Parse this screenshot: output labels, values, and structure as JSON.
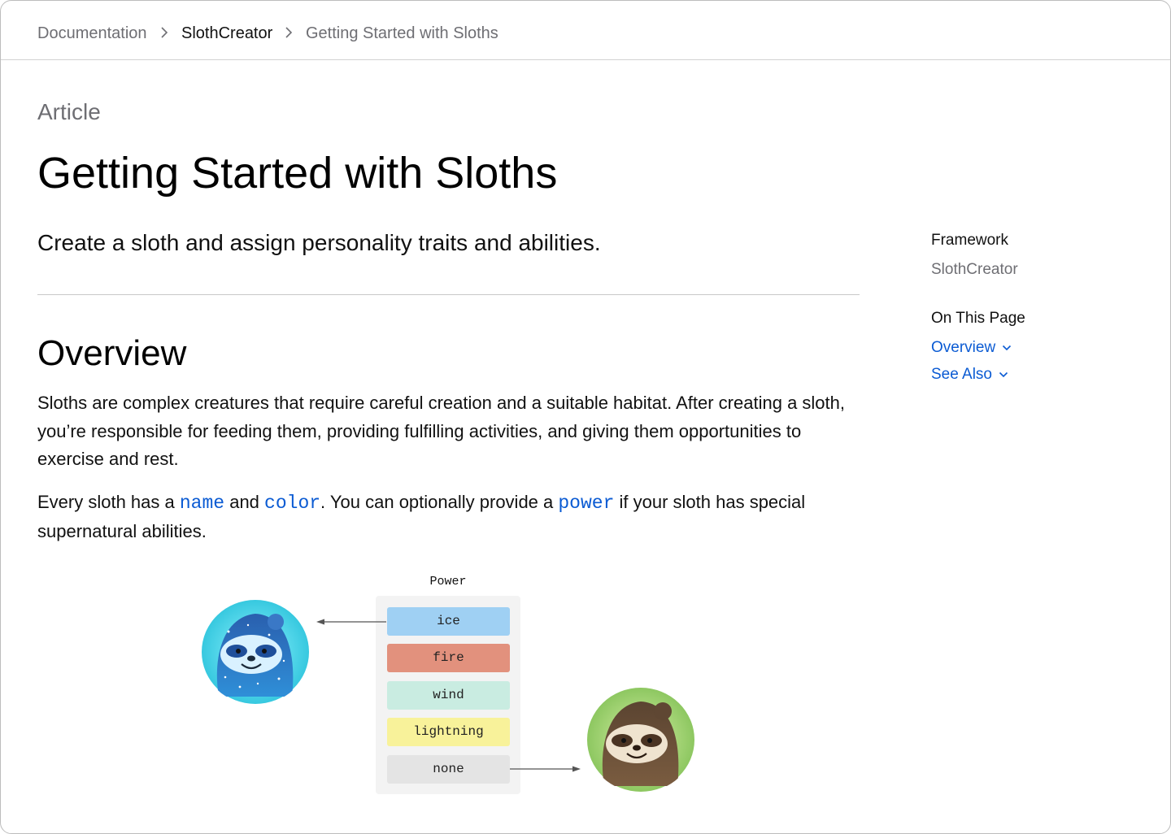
{
  "breadcrumb": {
    "items": [
      "Documentation",
      "SlothCreator",
      "Getting Started with Sloths"
    ]
  },
  "article": {
    "eyebrow": "Article",
    "title": "Getting Started with Sloths",
    "abstract": "Create a sloth and assign personality traits and abilities."
  },
  "overview": {
    "heading": "Overview",
    "paragraph1": "Sloths are complex creatures that require careful creation and a suitable habitat. After creating a sloth, you’re responsible for feeding them, providing fulfilling activities, and giving them opportunities to exercise and rest.",
    "p2_part1": "Every sloth has a ",
    "p2_code1": "name",
    "p2_part2": " and ",
    "p2_code2": "color",
    "p2_part3": ". You can optionally provide a ",
    "p2_code3": "power",
    "p2_part4": " if your sloth has special supernatural abilities."
  },
  "sidebar": {
    "framework_label": "Framework",
    "framework_value": "SlothCreator",
    "on_this_page_label": "On This Page",
    "links": [
      "Overview",
      "See Also"
    ]
  },
  "figure": {
    "caption": "Power",
    "powers": [
      {
        "label": "ice",
        "color": "#9fd0f3"
      },
      {
        "label": "fire",
        "color": "#e2917d"
      },
      {
        "label": "wind",
        "color": "#c9ece1"
      },
      {
        "label": "lightning",
        "color": "#f8f29a"
      },
      {
        "label": "none",
        "color": "#e4e4e4"
      }
    ]
  },
  "colors": {
    "link": "#0b5bd3",
    "muted": "#6e6e73"
  }
}
